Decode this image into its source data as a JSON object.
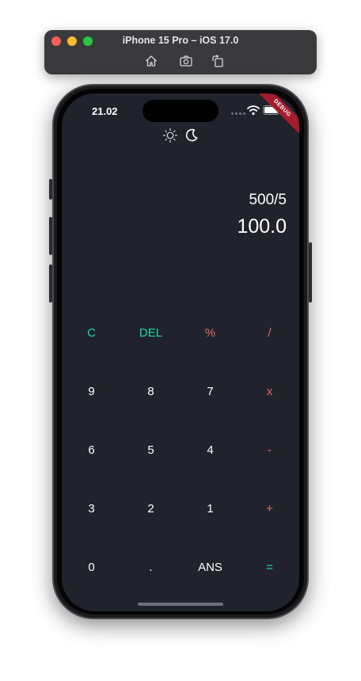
{
  "simulator": {
    "title": "iPhone 15 Pro – iOS 17.0",
    "tools": [
      "home-icon",
      "screenshot-icon",
      "rotate-icon"
    ]
  },
  "status_bar": {
    "time": "21.02",
    "debug_label": "DEBUG"
  },
  "theme_toggle": {
    "light_icon": "sun-icon",
    "dark_icon": "moon-icon"
  },
  "display": {
    "expression": "500/5",
    "result": "100.0"
  },
  "colors": {
    "background": "#20232b",
    "accent_teal": "#20d6b0",
    "accent_red": "#e76b6b",
    "text": "#ffffff"
  },
  "keypad": {
    "rows": [
      [
        {
          "label": "C",
          "tone": "teal"
        },
        {
          "label": "DEL",
          "tone": "teal"
        },
        {
          "label": "%",
          "tone": "red"
        },
        {
          "label": "/",
          "tone": "red"
        }
      ],
      [
        {
          "label": "9",
          "tone": "white"
        },
        {
          "label": "8",
          "tone": "white"
        },
        {
          "label": "7",
          "tone": "white"
        },
        {
          "label": "x",
          "tone": "red"
        }
      ],
      [
        {
          "label": "6",
          "tone": "white"
        },
        {
          "label": "5",
          "tone": "white"
        },
        {
          "label": "4",
          "tone": "white"
        },
        {
          "label": "-",
          "tone": "red"
        }
      ],
      [
        {
          "label": "3",
          "tone": "white"
        },
        {
          "label": "2",
          "tone": "white"
        },
        {
          "label": "1",
          "tone": "white"
        },
        {
          "label": "+",
          "tone": "red"
        }
      ],
      [
        {
          "label": "0",
          "tone": "white"
        },
        {
          "label": ".",
          "tone": "white"
        },
        {
          "label": "ANS",
          "tone": "white"
        },
        {
          "label": "=",
          "tone": "teal"
        }
      ]
    ]
  }
}
